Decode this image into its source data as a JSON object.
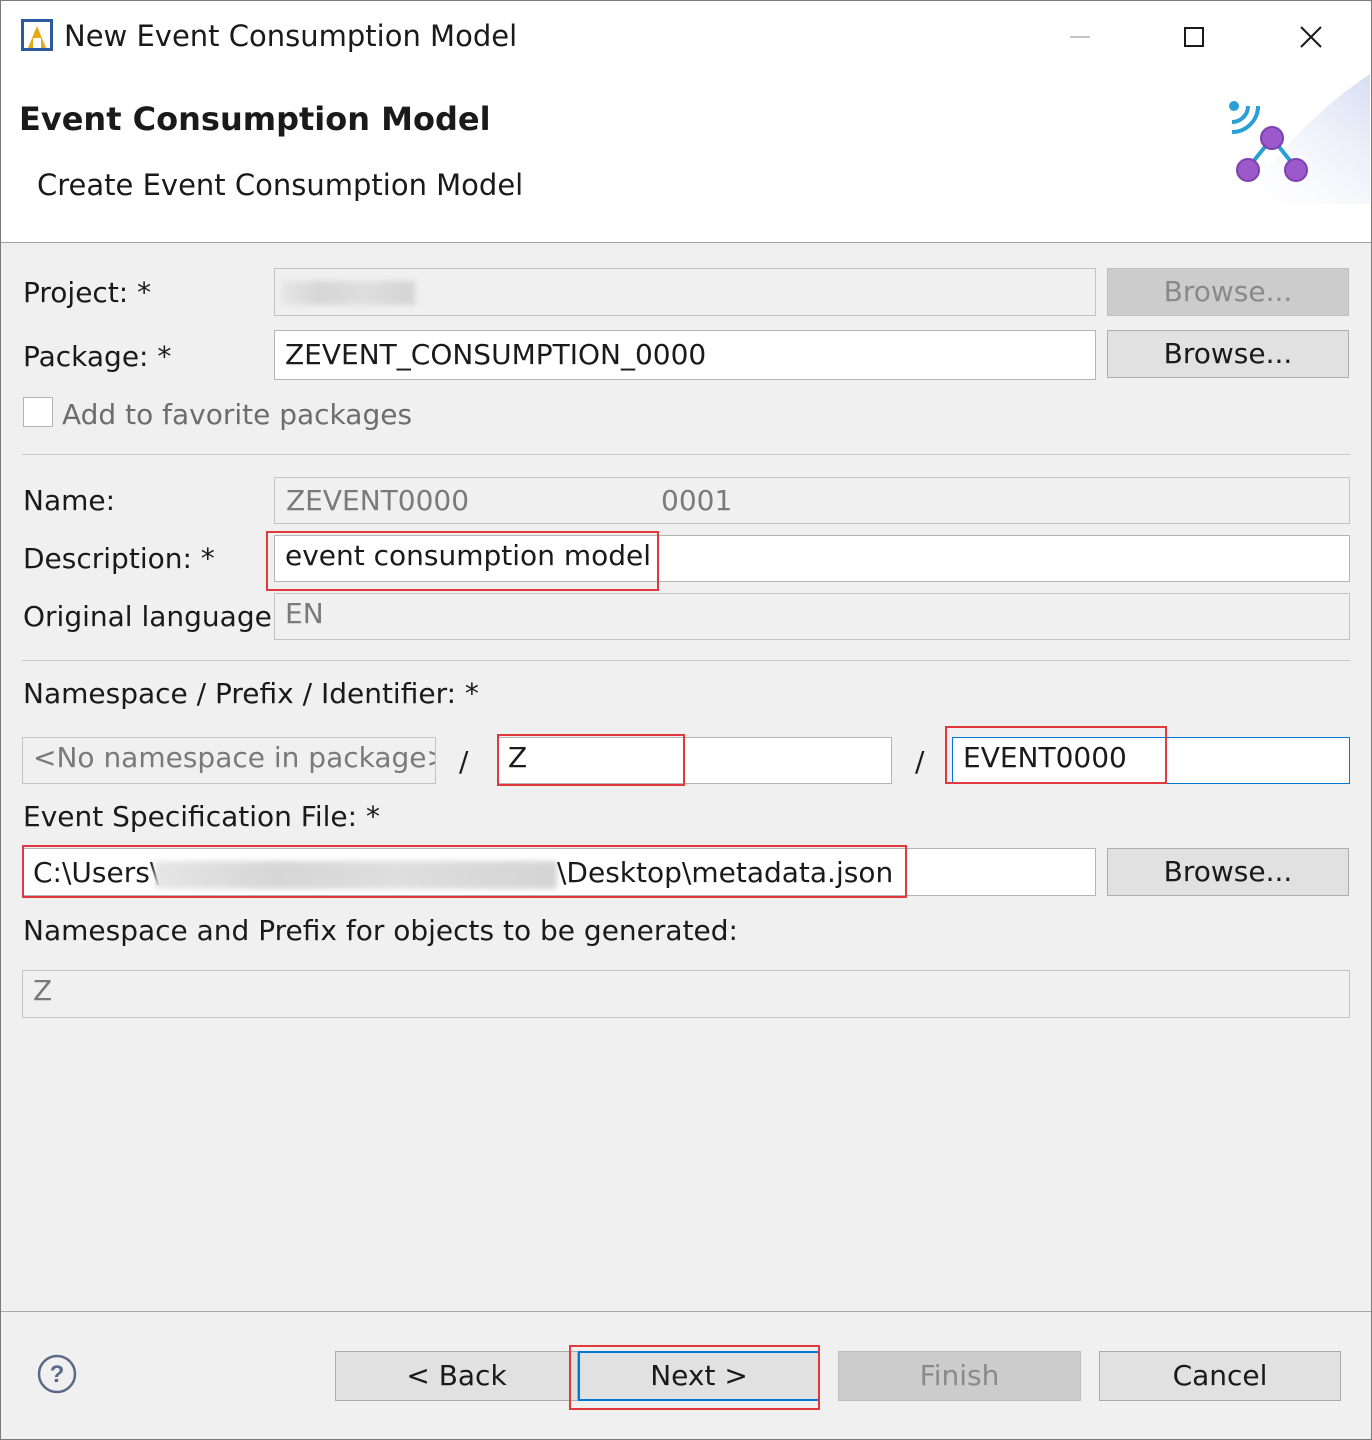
{
  "window": {
    "title": "New Event Consumption Model",
    "minimize_icon": "minimize-icon",
    "maximize_icon": "maximize-icon",
    "close_icon": "close-icon"
  },
  "header": {
    "title": "Event Consumption Model",
    "subtitle": "Create Event Consumption Model",
    "graphic_icon": "event-network-icon"
  },
  "form": {
    "project": {
      "label": "Project: *",
      "value": "",
      "browse": "Browse..."
    },
    "package": {
      "label": "Package: *",
      "value": "ZEVENT_CONSUMPTION_0000",
      "browse": "Browse..."
    },
    "favorite": {
      "label": "Add to favorite packages",
      "checked": false
    },
    "name": {
      "label": "Name:",
      "value_part1": "ZEVENT0000",
      "value_part2": "0001"
    },
    "description": {
      "label": "Description: *",
      "value": "event consumption model"
    },
    "language": {
      "label": "Original language:",
      "value": "EN"
    },
    "namespace": {
      "label": "Namespace / Prefix / Identifier: *",
      "namespace_value": "<No namespace in package>",
      "separator": "/",
      "prefix_value": "Z",
      "identifier_value": "EVENT0000"
    },
    "spec_file": {
      "label": "Event Specification File: *",
      "value_start": "C:\\Users\\",
      "value_end": "\\Desktop\\metadata.json",
      "browse": "Browse..."
    },
    "generated_prefix": {
      "label": "Namespace and Prefix for objects to be generated:",
      "value": "Z"
    }
  },
  "footer": {
    "help_icon": "help-icon",
    "back": "< Back",
    "next": "Next >",
    "finish": "Finish",
    "cancel": "Cancel"
  },
  "colors": {
    "highlight": "#e0393e",
    "focus": "#0078d7",
    "icon_purple": "#9b59c9",
    "icon_blue": "#2a9fd6"
  }
}
